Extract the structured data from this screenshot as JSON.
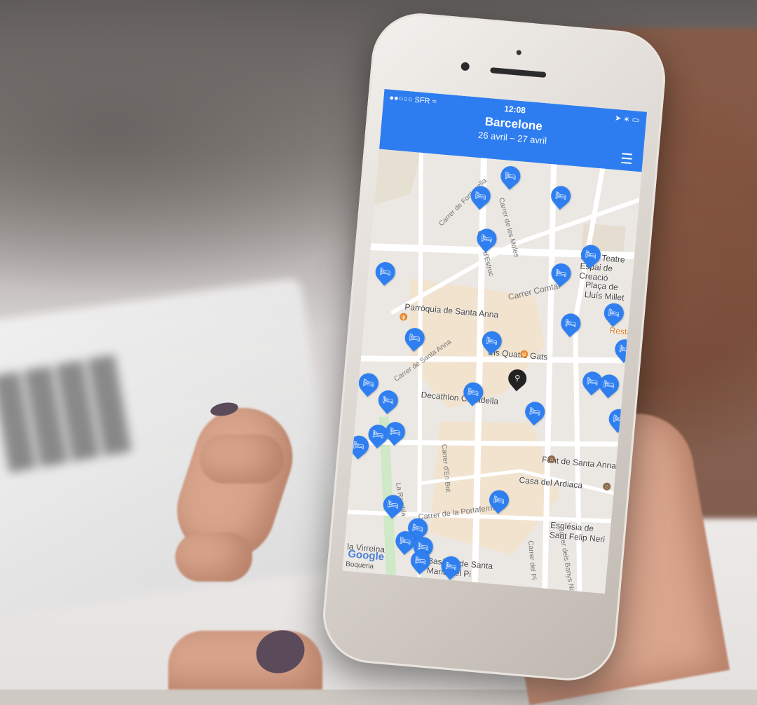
{
  "status_bar": {
    "carrier": "●●○○○ SFR ≈",
    "time": "12:08",
    "battery": "➤ ∗ ▭"
  },
  "header": {
    "city": "Barcelone",
    "dates": "26 avril – 27 avril",
    "list_icon": "☰"
  },
  "map": {
    "places": [
      "Parròquia de Santa Anna",
      "Els Quatre Gats",
      "Decathlon Ciutadella",
      "Font de Santa Anna",
      "Casa del Ardiaca",
      "Església de Sant Felip Neri",
      "la Virreina",
      "Basílica de Santa Maria del Pi",
      "Antic Teatre Espai de Creació",
      "Plaça de Lluís Millet",
      "Restaurant"
    ],
    "streets": [
      "Carrer de Fontanella",
      "Carrer de les Moles",
      "Carrer d'Estruc",
      "Carrer Comtal",
      "Carrer de Santa Anna",
      "Carrer d'En Bot",
      "Carrer de la Portaferrissa",
      "Carrer del Pi",
      "Carrer dels Banys Nous",
      "La Rambla"
    ],
    "google_label": "Google",
    "boqueria_label": "Boqueria",
    "pin_icon": "🛏",
    "center_pin_icon": "⚲",
    "hotel_pin_count": 34,
    "accent_color": "#2f7ff0"
  }
}
